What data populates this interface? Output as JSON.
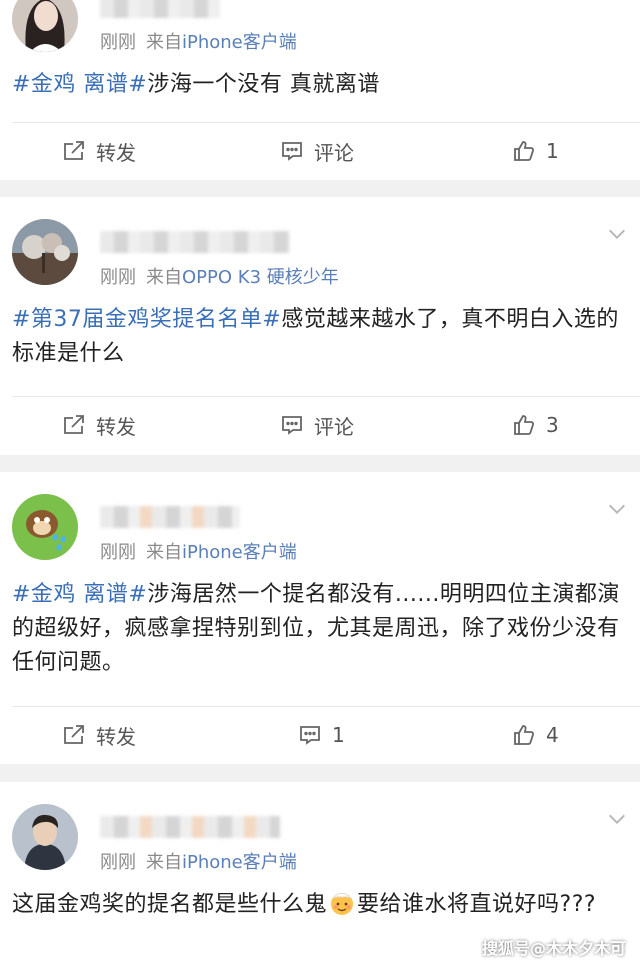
{
  "posts": [
    {
      "time": "刚刚",
      "from_prefix": "来自",
      "source": "iPhone客户端",
      "content_parts": [
        {
          "text": "#金鸡 离谱#",
          "tag": true
        },
        {
          "text": "涉海一个没有 真就离谱",
          "tag": false
        }
      ],
      "actions": {
        "repost": "转发",
        "comment": "评论",
        "like_count": "1"
      }
    },
    {
      "time": "刚刚",
      "from_prefix": "来自",
      "source": "OPPO K3 硬核少年",
      "content_parts": [
        {
          "text": "#第37届金鸡奖提名名单#",
          "tag": true
        },
        {
          "text": "感觉越来越水了，真不明白入选的标准是什么",
          "tag": false
        }
      ],
      "actions": {
        "repost": "转发",
        "comment": "评论",
        "like_count": "3"
      }
    },
    {
      "time": "刚刚",
      "from_prefix": "来自",
      "source": "iPhone客户端",
      "content_parts": [
        {
          "text": "#金鸡 离谱#",
          "tag": true
        },
        {
          "text": "涉海居然一个提名都没有......明明四位主演都演的超级好，疯感拿捏特别到位，尤其是周迅，除了戏份少没有任何问题。",
          "tag": false
        }
      ],
      "actions": {
        "repost": "转发",
        "comment_count": "1",
        "like_count": "4"
      }
    },
    {
      "time": "刚刚",
      "from_prefix": "来自",
      "source": "iPhone客户端",
      "content_parts": [
        {
          "text": "这届金鸡奖的提名都是些什么鬼",
          "tag": false
        },
        {
          "text": "要给谁水将直说好吗???",
          "tag": false
        }
      ],
      "emoji": "hot-face-emoji"
    }
  ],
  "watermark": "搜狐号@木木夕木可",
  "colors": {
    "tag": "#3a6fb8",
    "source": "#5a7fb8",
    "meta": "#8a8a8a",
    "background": "#f1f1f1"
  },
  "icons": [
    "share-icon",
    "comment-icon",
    "thumbs-up-icon",
    "chevron-down-icon"
  ]
}
